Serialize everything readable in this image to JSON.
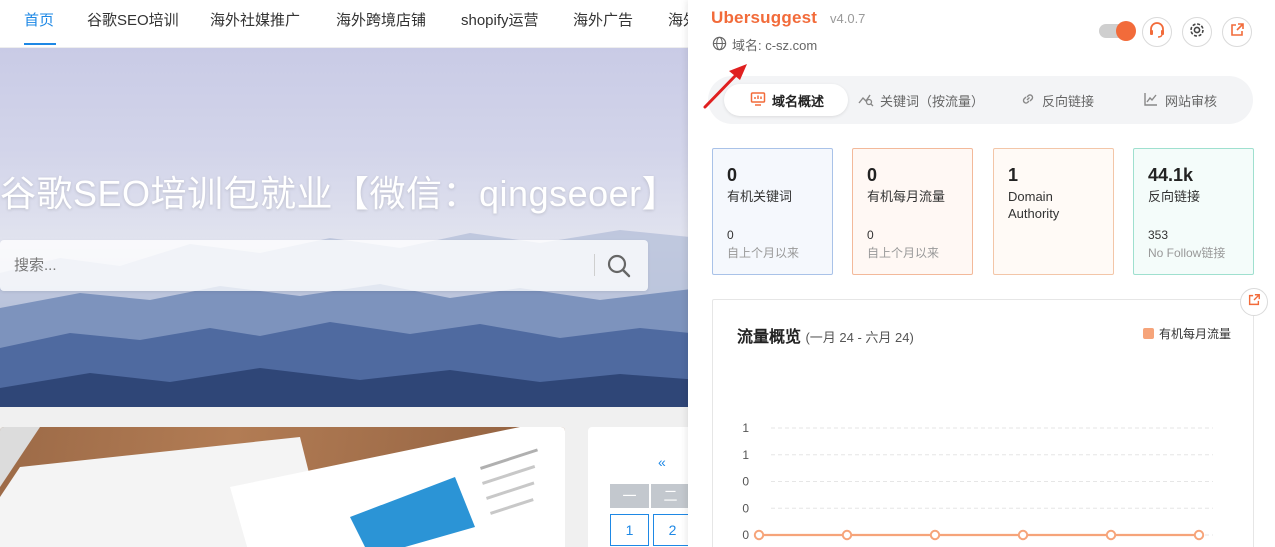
{
  "site": {
    "nav": [
      "首页",
      "谷歌SEO培训",
      "海外社媒推广",
      "海外跨境店铺",
      "shopify运营",
      "海外广告",
      "海外"
    ],
    "hero_title": "谷歌SEO培训包就业【微信：qingseoer】",
    "search_placeholder": "搜索...",
    "calendar": {
      "prev": "«",
      "headers": [
        "一",
        "二"
      ],
      "days": [
        "1",
        "2"
      ]
    },
    "accent_color": "#1e88e5"
  },
  "panel": {
    "brand": "Ubersuggest",
    "version": "v4.0.7",
    "domain_label": "域名: c-sz.com",
    "brand_color": "#f26b3a",
    "tabs": [
      {
        "label": "域名概述",
        "icon": "monitor-chart-icon",
        "active": true
      },
      {
        "label": "关键词（按流量）",
        "icon": "keyword-search-icon",
        "active": false
      },
      {
        "label": "反向链接",
        "icon": "link-icon",
        "active": false
      },
      {
        "label": "网站审核",
        "icon": "line-chart-icon",
        "active": false
      }
    ],
    "metrics": [
      {
        "value": "0",
        "label": "有机关键词",
        "sub_value": "0",
        "sub_label": "自上个月以来",
        "border": "#a9c2e8",
        "bg": "#f5f8fd"
      },
      {
        "value": "0",
        "label": "有机每月流量",
        "sub_value": "0",
        "sub_label": "自上个月以来",
        "border": "#f3b99a",
        "bg": "#fff8f4"
      },
      {
        "value": "1",
        "label": "Domain Authority",
        "sub_value": "",
        "sub_label": "",
        "border": "#f3c6a8",
        "bg": "#fffaf6"
      },
      {
        "value": "44.1k",
        "label": "反向链接",
        "sub_value": "353",
        "sub_label": "No Follow链接",
        "border": "#9fe0cf",
        "bg": "#f4fcfa"
      }
    ],
    "traffic": {
      "title": "流量概览",
      "range": "(一月 24 - 六月 24)",
      "legend": "有机每月流量"
    }
  },
  "chart_data": {
    "type": "line",
    "title": "流量概览",
    "subtitle": "(一月 24 - 六月 24)",
    "y_tick_labels": [
      "1",
      "1",
      "0",
      "0",
      "0"
    ],
    "series": [
      {
        "name": "有机每月流量",
        "color": "#f6a47a",
        "values": [
          0,
          0,
          0,
          0,
          0,
          0
        ]
      }
    ],
    "legend_position": "top-right",
    "grid": true
  }
}
